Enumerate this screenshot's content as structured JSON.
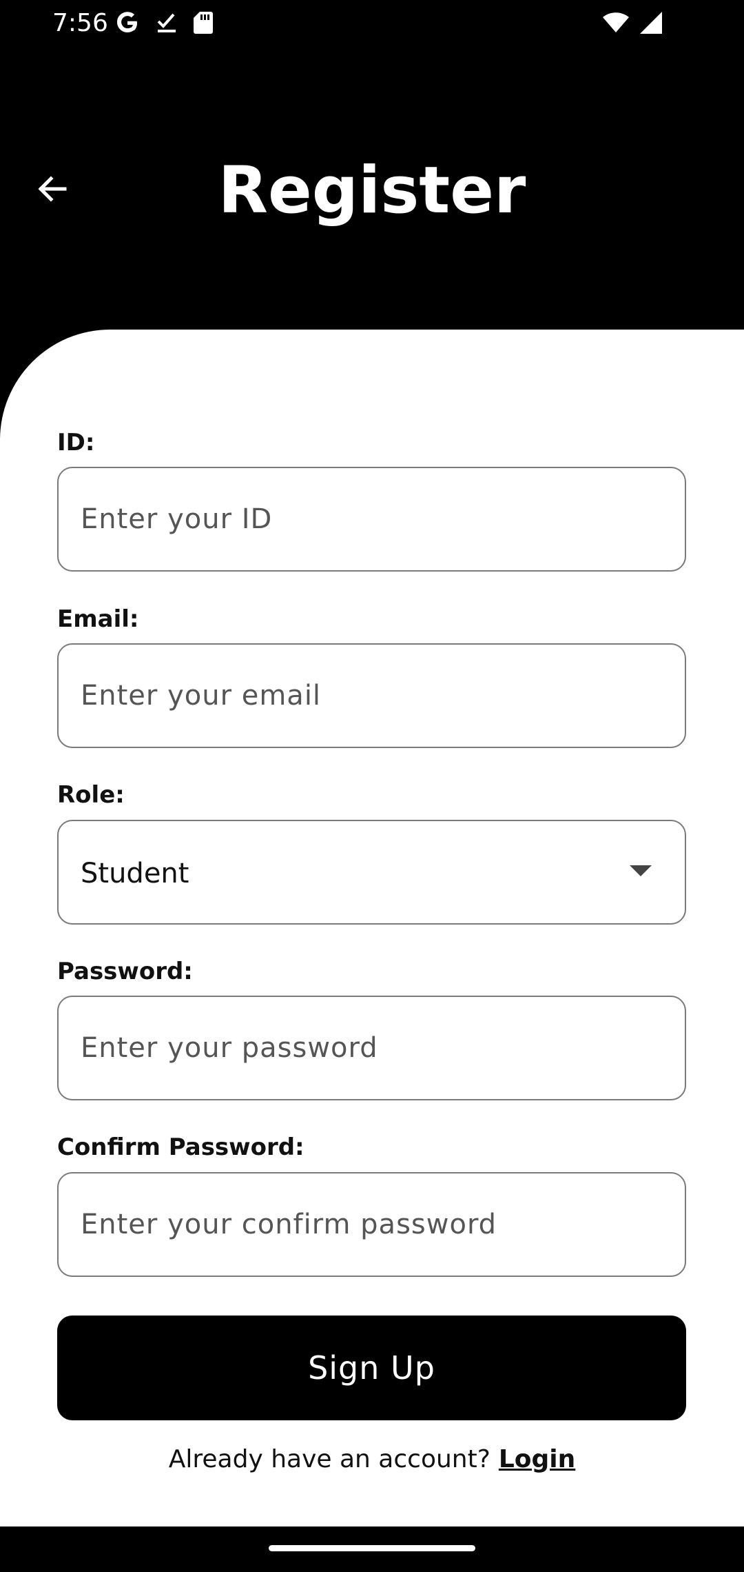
{
  "status_bar": {
    "time": "7:56",
    "left_icons": [
      "google-icon",
      "download-done-icon",
      "sd-card-icon"
    ],
    "right_icons": [
      "wifi-icon",
      "cell-signal-icon"
    ]
  },
  "header": {
    "title": "Register",
    "back_icon": "arrow-left-icon"
  },
  "form": {
    "id": {
      "label": "ID:",
      "placeholder": "Enter your ID",
      "value": ""
    },
    "email": {
      "label": "Email:",
      "placeholder": "Enter your email",
      "value": ""
    },
    "role": {
      "label": "Role:",
      "selected": "Student"
    },
    "password": {
      "label": "Password:",
      "placeholder": "Enter your password",
      "value": ""
    },
    "confirm_password": {
      "label": "Confirm Password:",
      "placeholder": "Enter your confirm password",
      "value": ""
    },
    "submit_label": "Sign Up"
  },
  "footer": {
    "prompt": "Already have an account?",
    "link_label": "Login"
  },
  "colors": {
    "background": "#000000",
    "panel": "#ffffff",
    "button": "#000000",
    "button_text": "#ffffff",
    "border": "#7a7a7a"
  }
}
